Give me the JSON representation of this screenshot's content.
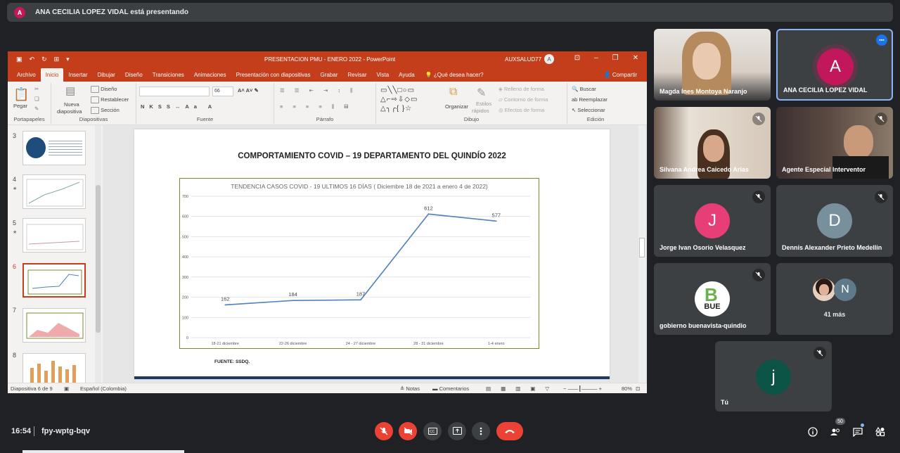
{
  "meet": {
    "presenting_text": "ANA CECILIA LOPEZ VIDAL está presentando",
    "presenter_initial": "A",
    "time": "16:54",
    "meeting_code": "fpy-wptg-bqv",
    "people_count": "50"
  },
  "ppt": {
    "window_title": "PRESENTACION PMU - ENERO 2022  -  PowerPoint",
    "user": "AUXSALUD77",
    "user_initial": "A",
    "tabs": [
      "Archivo",
      "Inicio",
      "Insertar",
      "Dibujar",
      "Diseño",
      "Transiciones",
      "Animaciones",
      "Presentación con diapositivas",
      "Grabar",
      "Revisar",
      "Vista",
      "Ayuda"
    ],
    "help_search": "¿Qué desea hacer?",
    "share": "Compartir",
    "ribbon": {
      "paste": "Pegar",
      "clipboard": "Portapapeles",
      "new_slide_1": "Nueva",
      "new_slide_2": "diapositiva",
      "design": "Diseño",
      "reset": "Restablecer",
      "section": "Sección",
      "slides": "Diapositivas",
      "font_size": "66",
      "font": "Fuente",
      "paragraph": "Párrafo",
      "organize": "Organizar",
      "quick_styles_1": "Estilos",
      "quick_styles_2": "rápidos",
      "fill": "Relleno de forma",
      "outline": "Contorno de forma",
      "effects": "Efectos de forma",
      "drawing": "Dibujo",
      "find": "Buscar",
      "replace": "Reemplazar",
      "select": "Seleccionar",
      "editing": "Edición"
    },
    "thumb_numbers": [
      "3",
      "4",
      "5",
      "6",
      "7",
      "8"
    ],
    "slide": {
      "title": "COMPORTAMIENTO COVID – 19 DEPARTAMENTO DEL QUINDÍO 2022",
      "source": "FUENTE: SSDQ."
    },
    "status": {
      "slide_of": "Diapositiva 6 de 9",
      "language": "Español (Colombia)",
      "notes": "Notas",
      "comments": "Comentarios",
      "zoom": "80%"
    }
  },
  "chart_data": {
    "type": "line",
    "title": "TENDENCIA CASOS COVID - 19 ULTIMOS 16 DÍAS  ( Diciembre 18 de 2021  a enero 4 de 2022)",
    "categories": [
      "18-21 diciembre",
      "22-26 diciembre",
      "24 - 27 diciembre",
      "28 - 31 diciembre",
      "1-4 enero"
    ],
    "values": [
      162,
      184,
      187,
      612,
      577
    ],
    "yticks": [
      0,
      100,
      200,
      300,
      400,
      500,
      600,
      700
    ],
    "ylim": [
      0,
      700
    ],
    "grid": true,
    "line_color": "#4f81bd"
  },
  "participants": [
    {
      "name": "Magda Ines Montoya Naranjo",
      "video": true
    },
    {
      "name": "ANA CECILIA LOPEZ VIDAL",
      "initial": "A",
      "color": "#c2185b",
      "speaking": true
    },
    {
      "name": "Silvana Andrea Caicedo Arias",
      "video": true
    },
    {
      "name": "Agente Especial Interventor",
      "video": true
    },
    {
      "name": "Jorge Ivan Osorio Velasquez",
      "initial": "J",
      "color": "#e83e78"
    },
    {
      "name": "Dennis Alexander Prieto Medellin",
      "initial": "D",
      "color": "#78909c"
    },
    {
      "name": "gobierno buenavista-quindio",
      "logo_text": "BUE"
    },
    {
      "name": "41 más",
      "initial": "N",
      "color": "#5f7a8a"
    },
    {
      "name": "Tú",
      "initial": "j",
      "color": "#0b5345"
    }
  ]
}
